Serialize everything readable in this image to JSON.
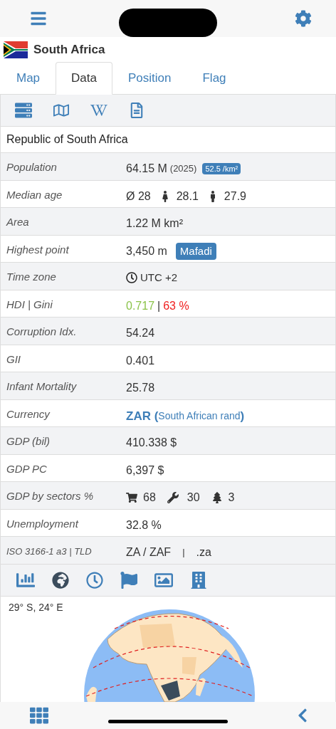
{
  "header": {
    "title": "South Africa"
  },
  "tabs": [
    {
      "label": "Map",
      "selected": false
    },
    {
      "label": "Data",
      "selected": true
    },
    {
      "label": "Position",
      "selected": false
    },
    {
      "label": "Flag",
      "selected": false
    }
  ],
  "official_name": "Republic of South Africa",
  "rows": [
    {
      "kind": "population",
      "label": "Population",
      "value": "64.15 M",
      "note": "(2025)",
      "badge": "52.5 /km²"
    },
    {
      "kind": "age",
      "label": "Median age",
      "value": "Ø 28",
      "female": "28.1",
      "male": "27.9"
    },
    {
      "kind": "text",
      "label": "Area",
      "value": "1.22 M km²"
    },
    {
      "kind": "badge",
      "label": "Highest point",
      "value": "3,450 m",
      "badge": "Mafadi"
    },
    {
      "kind": "time",
      "label": "Time zone",
      "value": "UTC +2"
    },
    {
      "kind": "hdi",
      "label": "HDI | Gini",
      "hdi": "0.717",
      "separator": "|",
      "gini": "63 %"
    },
    {
      "kind": "text",
      "label": "Corruption Idx.",
      "value": "54.24"
    },
    {
      "kind": "text",
      "label": "GII",
      "value": "0.401"
    },
    {
      "kind": "text",
      "label": "Infant Mortality",
      "value": "25.78"
    },
    {
      "kind": "currency",
      "label": "Currency",
      "code": "ZAR",
      "open": "(",
      "name": "South African rand",
      "close": ")"
    },
    {
      "kind": "text",
      "label": "GDP (bil)",
      "value": "410.338 $"
    },
    {
      "kind": "text",
      "label": "GDP PC",
      "value": "6,397 $"
    },
    {
      "kind": "sectors",
      "label": "GDP by sectors %",
      "services": "68",
      "industry": "30",
      "agriculture": "3"
    },
    {
      "kind": "text",
      "label": "Unemployment",
      "value": "32.8 %"
    },
    {
      "kind": "iso",
      "label": "ISO 3166-1 a3 | TLD",
      "value": "ZA / ZAF",
      "separator": "|",
      "tld": ".za"
    }
  ],
  "map": {
    "coordinates": "29° S, 24° E"
  }
}
